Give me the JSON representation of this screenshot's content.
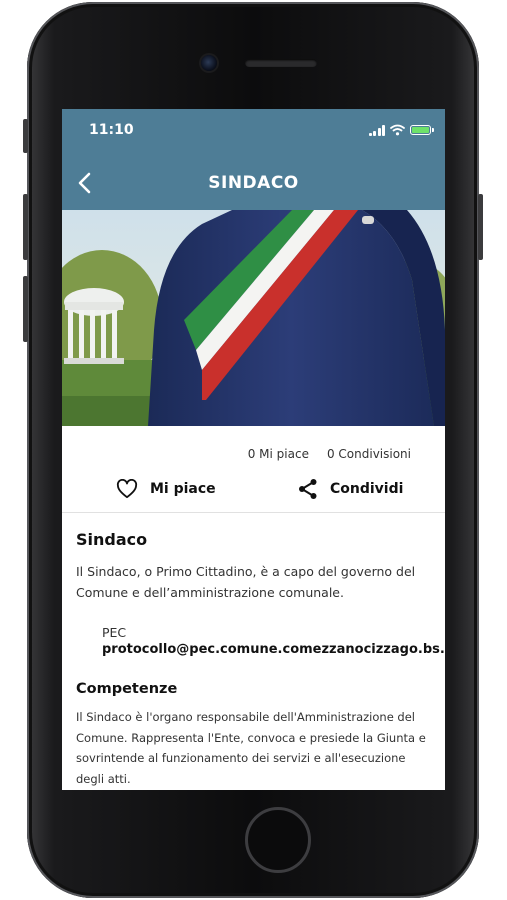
{
  "status_bar": {
    "time": "11:10"
  },
  "header": {
    "title": "SINDACO",
    "back_icon": "chevron-left-icon",
    "background": "#4e7d96"
  },
  "hero": {
    "image": "mayor-with-tricolor-sash"
  },
  "stats": {
    "likes": "0 Mi piace",
    "shares": "0 Condivisioni"
  },
  "actions": {
    "like_label": "Mi piace",
    "like_icon": "heart-icon",
    "share_label": "Condividi",
    "share_icon": "share-icon"
  },
  "content": {
    "title": "Sindaco",
    "description": "Il Sindaco, o Primo Cittadino, è a capo del governo del Comune e dell’amministrazione comunale.",
    "pec_label": "PEC",
    "pec_value": "protocollo@pec.comune.comezzanocizzago.bs.it",
    "competenze_title": "Competenze",
    "competenze_text": "Il Sindaco è l'organo responsabile dell'Amministrazione del Comune. Rappresenta l'Ente, convoca e presiede la Giunta e sovrintende al funzionamento dei servizi e all'esecuzione degli atti."
  }
}
